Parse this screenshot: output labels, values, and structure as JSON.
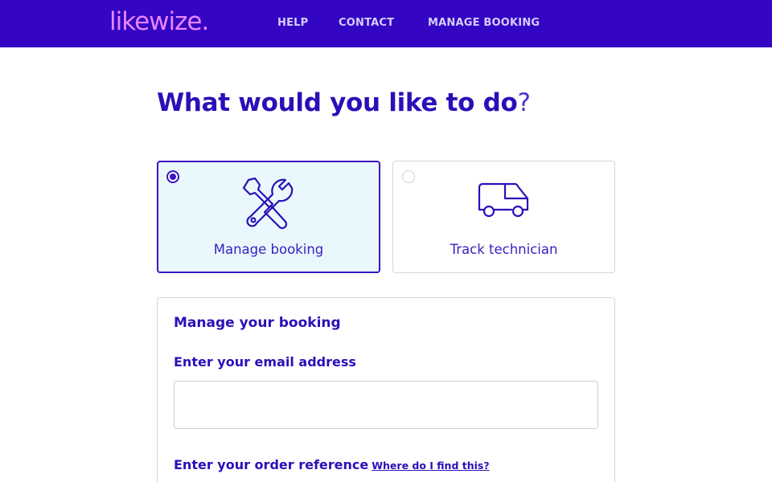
{
  "header": {
    "logo": "likewize.",
    "nav": [
      "HELP",
      "CONTACT",
      "MANAGE BOOKING"
    ]
  },
  "main": {
    "heading": "What would you like to do",
    "heading_mark": "?",
    "options": [
      {
        "label": "Manage booking",
        "icon": "tools-icon",
        "selected": true
      },
      {
        "label": "Track technician",
        "icon": "van-icon",
        "selected": false
      }
    ]
  },
  "form": {
    "title": "Manage your booking",
    "email_label": "Enter your email address",
    "email_value": "",
    "order_label": "Enter your order reference",
    "order_help_link": "Where do I find this?"
  },
  "colors": {
    "header_bg": "#3405c2",
    "logo": "#e985ff",
    "primary_text": "#2b0fb8",
    "selected_bg": "#e9f8fc"
  }
}
